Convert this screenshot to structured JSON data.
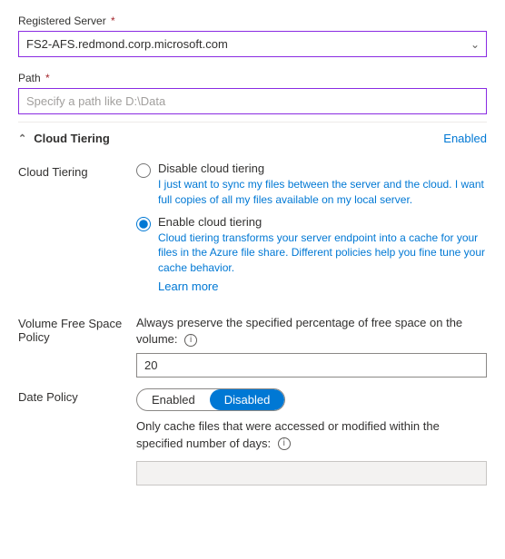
{
  "registeredServer": {
    "label": "Registered Server",
    "required": true,
    "value": "FS2-AFS.redmond.corp.microsoft.com",
    "options": [
      "FS2-AFS.redmond.corp.microsoft.com"
    ]
  },
  "path": {
    "label": "Path",
    "required": true,
    "placeholder": "Specify a path like D:\\Data"
  },
  "cloudTiering": {
    "sectionLabel": "Cloud Tiering",
    "statusLabel": "Enabled",
    "fieldLabel": "Cloud Tiering",
    "options": [
      {
        "label": "Disable cloud tiering",
        "description": "I just want to sync my files between the server and the cloud. I want full copies of all my files available on my local server.",
        "checked": false
      },
      {
        "label": "Enable cloud tiering",
        "description": "Cloud tiering transforms your server endpoint into a cache for your files in the Azure file share. Different policies help you fine tune your cache behavior.",
        "checked": true
      }
    ],
    "learnMoreLabel": "Learn more"
  },
  "volumeFreeSpacePolicy": {
    "label": "Volume Free Space Policy",
    "description": "Always preserve the specified percentage of free space on the volume:",
    "value": "20"
  },
  "datePolicy": {
    "label": "Date Policy",
    "toggleOptions": [
      "Enabled",
      "Disabled"
    ],
    "activeToggle": "Disabled",
    "description": "Only cache files that were accessed or modified within the specified number of days:"
  },
  "icons": {
    "chevronDown": "⌄",
    "chevronUp": "^",
    "info": "i"
  }
}
